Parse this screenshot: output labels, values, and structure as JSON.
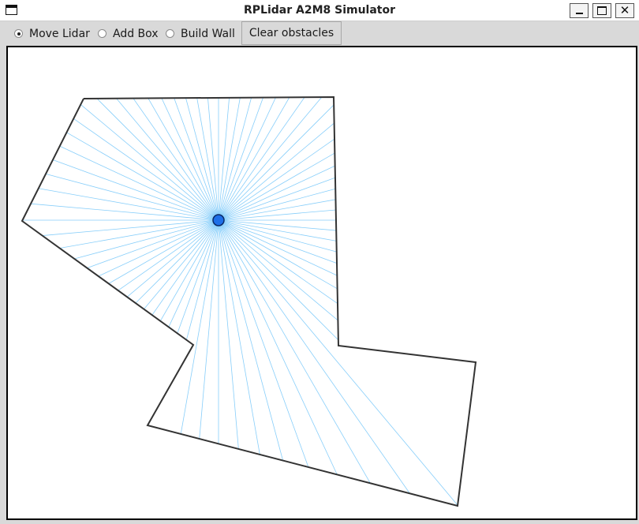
{
  "window": {
    "title": "RPLidar A2M8 Simulator"
  },
  "toolbar": {
    "modes": [
      {
        "label": "Move Lidar",
        "selected": true
      },
      {
        "label": "Add Box",
        "selected": false
      },
      {
        "label": "Build Wall",
        "selected": false
      }
    ],
    "clear_label": "Clear obstacles"
  },
  "colors": {
    "ray": "#87cefa",
    "wall": "#333333",
    "lidar_fill": "#1e6fe8",
    "lidar_outline": "#0a2a66"
  }
}
